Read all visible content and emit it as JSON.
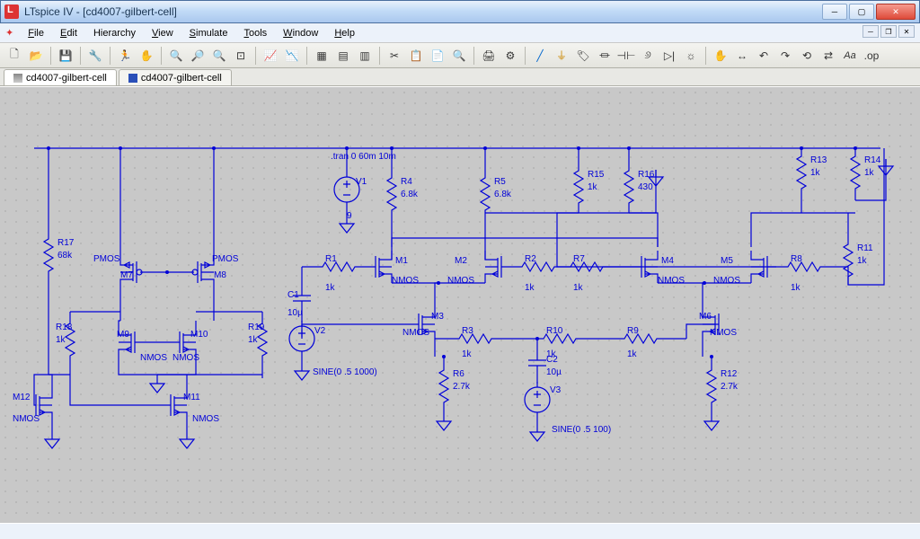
{
  "window": {
    "title": "LTspice IV - [cd4007-gilbert-cell]"
  },
  "menus": {
    "file": "File",
    "edit": "Edit",
    "hierarchy": "Hierarchy",
    "view": "View",
    "simulate": "Simulate",
    "tools": "Tools",
    "window": "Window",
    "help": "Help"
  },
  "tabs": {
    "t1": "cd4007-gilbert-cell",
    "t2": "cd4007-gilbert-cell"
  },
  "directive": ".tran 0 60m 10m",
  "components": {
    "R17": {
      "name": "R17",
      "val": "68k"
    },
    "R18": {
      "name": "R18",
      "val": "1k"
    },
    "R19": {
      "name": "R19",
      "val": "1k"
    },
    "R1": {
      "name": "R1",
      "val": "1k"
    },
    "R2": {
      "name": "R2",
      "val": "1k"
    },
    "R3": {
      "name": "R3",
      "val": "1k"
    },
    "R4": {
      "name": "R4",
      "val": "6.8k"
    },
    "R5": {
      "name": "R5",
      "val": "6.8k"
    },
    "R6": {
      "name": "R6",
      "val": "2.7k"
    },
    "R7": {
      "name": "R7",
      "val": "1k"
    },
    "R8": {
      "name": "R8",
      "val": "1k"
    },
    "R9": {
      "name": "R9",
      "val": "1k"
    },
    "R10": {
      "name": "R10",
      "val": "1k"
    },
    "R11": {
      "name": "R11",
      "val": "1k"
    },
    "R12": {
      "name": "R12",
      "val": "2.7k"
    },
    "R13": {
      "name": "R13",
      "val": "1k"
    },
    "R14": {
      "name": "R14",
      "val": "1k"
    },
    "R15": {
      "name": "R15",
      "val": "1k"
    },
    "R16": {
      "name": "R16",
      "val": "430"
    },
    "C1": {
      "name": "C1",
      "val": "10µ"
    },
    "C2": {
      "name": "C2",
      "val": "10µ"
    },
    "V1": {
      "name": "V1",
      "val": "9"
    },
    "V2": {
      "name": "V2",
      "val": "SINE(0 .5 1000)"
    },
    "V3": {
      "name": "V3",
      "val": "SINE(0 .5 100)"
    },
    "M1": {
      "name": "M1",
      "type": "NMOS"
    },
    "M2": {
      "name": "M2",
      "type": "NMOS"
    },
    "M3": {
      "name": "M3",
      "type": "NMOS"
    },
    "M4": {
      "name": "M4",
      "type": "NMOS"
    },
    "M5": {
      "name": "M5",
      "type": "NMOS"
    },
    "M6": {
      "name": "M6",
      "type": "NMOS"
    },
    "M7": {
      "name": "M7",
      "type": "PMOS"
    },
    "M8": {
      "name": "M8",
      "type": "PMOS"
    },
    "M9": {
      "name": "M9",
      "type": "NMOS"
    },
    "M10": {
      "name": "M10",
      "type": "NMOS"
    },
    "M11": {
      "name": "M11",
      "type": "NMOS"
    },
    "M12": {
      "name": "M12",
      "type": "NMOS"
    }
  }
}
